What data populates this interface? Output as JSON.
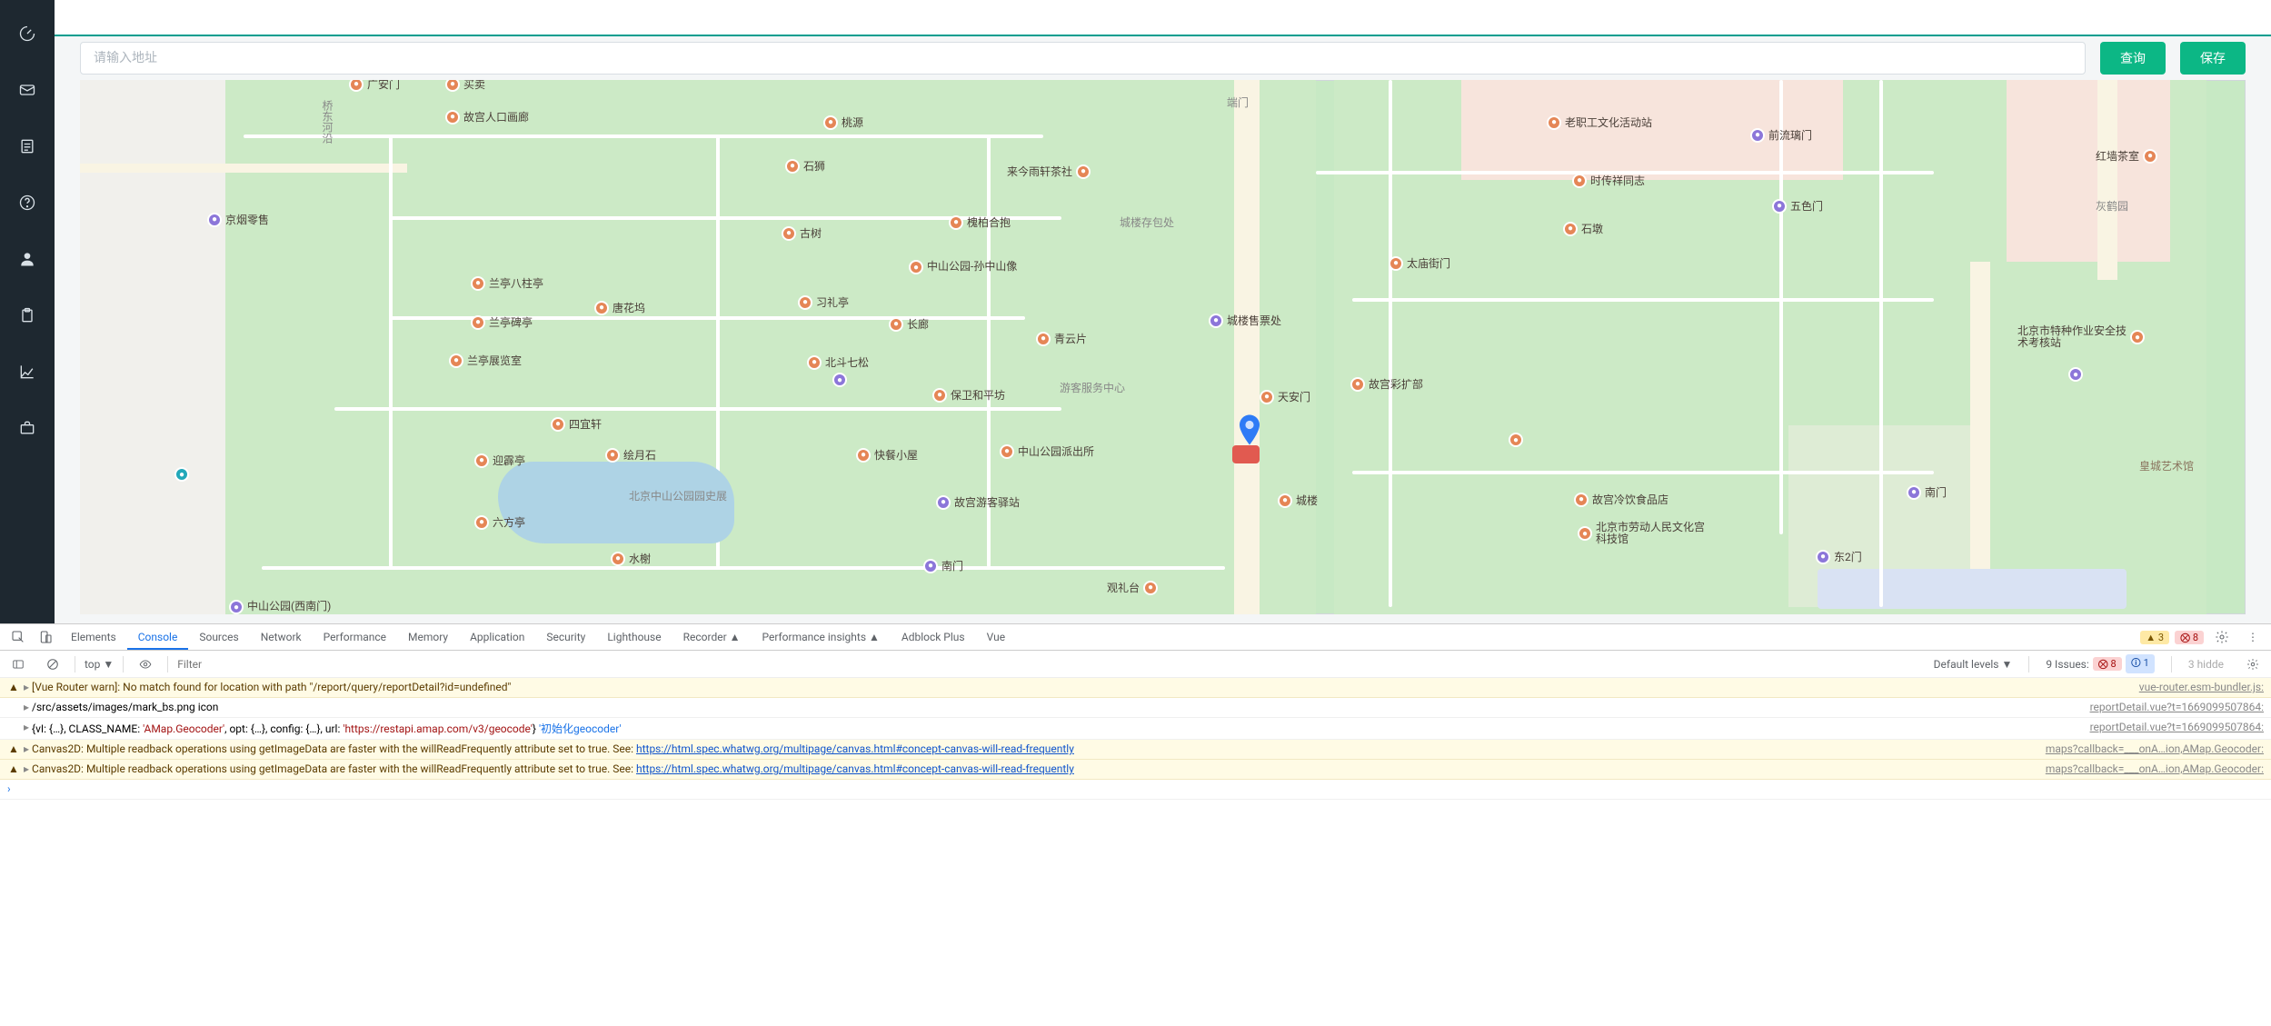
{
  "sidebar": {
    "items": [
      {
        "name": "sidebar-item-dashboard",
        "icon": "speedometer-icon"
      },
      {
        "name": "sidebar-item-inbox",
        "icon": "mail-icon"
      },
      {
        "name": "sidebar-item-docs",
        "icon": "document-icon"
      },
      {
        "name": "sidebar-item-help",
        "icon": "help-circle-icon"
      },
      {
        "name": "sidebar-item-user",
        "icon": "user-icon"
      },
      {
        "name": "sidebar-item-clipboard",
        "icon": "clipboard-icon"
      },
      {
        "name": "sidebar-item-chart",
        "icon": "chart-icon"
      },
      {
        "name": "sidebar-item-briefcase",
        "icon": "briefcase-icon"
      }
    ]
  },
  "search": {
    "placeholder": "请输入地址",
    "value": "",
    "query_label": "查询",
    "save_label": "保存"
  },
  "map": {
    "pois": [
      {
        "l": 296,
        "t": -4,
        "label": "广安门",
        "dot": "o"
      },
      {
        "l": 402,
        "t": -4,
        "label": "买卖",
        "dot": "o"
      },
      {
        "l": 1262,
        "t": 16,
        "label": "端门",
        "dot": "",
        "plain": true,
        "color": "#888"
      },
      {
        "l": 402,
        "t": 32,
        "label": "故宫人口画廊",
        "dot": "o"
      },
      {
        "l": 818,
        "t": 38,
        "label": "桃源",
        "dot": "o"
      },
      {
        "l": 264,
        "t": 22,
        "label": "桥东河沿",
        "dot": "",
        "plain": true,
        "vertical": true,
        "color": "#888"
      },
      {
        "l": 1614,
        "t": 38,
        "label": "老职工文化活动站",
        "dot": "o"
      },
      {
        "l": 1838,
        "t": 52,
        "label": "前流璃门",
        "dot": "p"
      },
      {
        "l": 776,
        "t": 86,
        "label": "石狮",
        "dot": "o"
      },
      {
        "l": 1020,
        "t": 92,
        "label": "来今雨轩茶社",
        "dot": "o",
        "flip": true
      },
      {
        "l": 1642,
        "t": 102,
        "label": "时传祥同志",
        "dot": "o"
      },
      {
        "l": 2218,
        "t": 75,
        "label": "红墙茶室",
        "dot": "o",
        "flip": true
      },
      {
        "l": 2218,
        "t": 130,
        "label": "灰鹤园",
        "dot": "",
        "plain": true,
        "color": "#888"
      },
      {
        "l": 140,
        "t": 145,
        "label": "京烟零售",
        "dot": "p"
      },
      {
        "l": 956,
        "t": 148,
        "label": "槐柏合抱",
        "dot": "o"
      },
      {
        "l": 1144,
        "t": 148,
        "label": "城楼存包处",
        "dot": "",
        "plain": true,
        "color": "#888"
      },
      {
        "l": 1862,
        "t": 130,
        "label": "五色门",
        "dot": "p"
      },
      {
        "l": 772,
        "t": 160,
        "label": "古树",
        "dot": "o"
      },
      {
        "l": 1632,
        "t": 155,
        "label": "石墩",
        "dot": "o"
      },
      {
        "l": 912,
        "t": 198,
        "label": "中山公园-孙中山像",
        "dot": "o",
        "two": true
      },
      {
        "l": 430,
        "t": 215,
        "label": "兰亭八柱亭",
        "dot": "o"
      },
      {
        "l": 1440,
        "t": 193,
        "label": "太庙街门",
        "dot": "o"
      },
      {
        "l": 566,
        "t": 242,
        "label": "唐花坞",
        "dot": "o"
      },
      {
        "l": 790,
        "t": 236,
        "label": "习礼亭",
        "dot": "o"
      },
      {
        "l": 430,
        "t": 258,
        "label": "兰亭碑亭",
        "dot": "o"
      },
      {
        "l": 890,
        "t": 260,
        "label": "长廊",
        "dot": "o"
      },
      {
        "l": 1242,
        "t": 256,
        "label": "城楼售票处",
        "dot": "p"
      },
      {
        "l": 2132,
        "t": 270,
        "label": "北京市特种作业安全技术考核站",
        "dot": "o",
        "two": true,
        "flip": true
      },
      {
        "l": 406,
        "t": 300,
        "label": "兰亭展览室",
        "dot": "o"
      },
      {
        "l": 1052,
        "t": 276,
        "label": "青云片",
        "dot": "o"
      },
      {
        "l": 800,
        "t": 302,
        "label": "北斗七松",
        "dot": "o"
      },
      {
        "l": 828,
        "t": 322,
        "label": "",
        "dot": "p",
        "purple_only": true
      },
      {
        "l": 1078,
        "t": 330,
        "label": "游客服务中心",
        "dot": "",
        "plain": true,
        "color": "#888"
      },
      {
        "l": 1298,
        "t": 340,
        "label": "天安门",
        "dot": "o"
      },
      {
        "l": 1398,
        "t": 326,
        "label": "故宫彩扩部",
        "dot": "o"
      },
      {
        "l": 2188,
        "t": 316,
        "label": "",
        "dot": "p",
        "purple_only": true
      },
      {
        "l": 938,
        "t": 338,
        "label": "保卫和平坊",
        "dot": "o"
      },
      {
        "l": 518,
        "t": 370,
        "label": "四宜轩",
        "dot": "o"
      },
      {
        "l": 578,
        "t": 404,
        "label": "绘月石",
        "dot": "o"
      },
      {
        "l": 434,
        "t": 410,
        "label": "迎霹亭",
        "dot": "o"
      },
      {
        "l": 854,
        "t": 404,
        "label": "快餐小屋",
        "dot": "o"
      },
      {
        "l": 1012,
        "t": 400,
        "label": "中山公园派出所",
        "dot": "o"
      },
      {
        "l": 1572,
        "t": 388,
        "label": "",
        "dot": "o",
        "orange_only": true
      },
      {
        "l": 2266,
        "t": 416,
        "label": "皇城艺术馆",
        "dot": "",
        "plain": true,
        "color": "#8a745e"
      },
      {
        "l": 942,
        "t": 456,
        "label": "故宫游客驿站",
        "dot": "p"
      },
      {
        "l": 604,
        "t": 452,
        "label": "北京中山公园园史展",
        "dot": "",
        "plain": true,
        "two": true,
        "color": "#888"
      },
      {
        "l": 1318,
        "t": 454,
        "label": "城楼",
        "dot": "o"
      },
      {
        "l": 1644,
        "t": 453,
        "label": "故宫冷饮食品店",
        "dot": "o"
      },
      {
        "l": 434,
        "t": 478,
        "label": "六方亭",
        "dot": "o"
      },
      {
        "l": 1648,
        "t": 486,
        "label": "北京市劳动人民文化宫科技馆",
        "dot": "o",
        "two": true
      },
      {
        "l": 1910,
        "t": 516,
        "label": "东2门",
        "dot": "p"
      },
      {
        "l": 584,
        "t": 518,
        "label": "水榭",
        "dot": "o"
      },
      {
        "l": 928,
        "t": 526,
        "label": "南门",
        "dot": "p"
      },
      {
        "l": 2010,
        "t": 445,
        "label": "南门",
        "dot": "p"
      },
      {
        "l": 104,
        "t": 426,
        "label": "",
        "dot": "t",
        "teal_only": true
      },
      {
        "l": 1130,
        "t": 550,
        "label": "观礼台",
        "dot": "o",
        "flip": true
      },
      {
        "l": 164,
        "t": 572,
        "label": "中山公园(西南门)",
        "dot": "p",
        "two": true
      }
    ]
  },
  "devtools": {
    "tabs": [
      "Elements",
      "Console",
      "Sources",
      "Network",
      "Performance",
      "Memory",
      "Application",
      "Security",
      "Lighthouse",
      "Recorder ▲",
      "Performance insights ▲",
      "Adblock Plus",
      "Vue"
    ],
    "active_tab": 1,
    "warn_count": "3",
    "err_count": "8",
    "scope": "top ▼",
    "filter_placeholder": "Filter",
    "levels": "Default levels ▼",
    "issues_label": "9 Issues:",
    "issues_err": "8",
    "issues_info": "1",
    "hidden": "3 hidde",
    "rows": [
      {
        "type": "warn",
        "msg_pre": "[Vue Router warn]: No match found for location with path \"/report/query/reportDetail?id=undefined\"",
        "src": "vue-router.esm-bundler.js:"
      },
      {
        "type": "log",
        "msg_pre": "/src/assets/images/mark_bs.png icon",
        "src": "reportDetail.vue?t=1669099507864:"
      },
      {
        "type": "log",
        "msg_obj": true,
        "obj_prefix": "{vI: {…}, CLASS_NAME: ",
        "obj_class": "'AMap.Geocoder'",
        "obj_mid": ", opt: {…}, config: {…}, url: ",
        "obj_url": "'https://restapi.amap.com/v3/geocode'",
        "obj_suffix": "}",
        "obj_tail": " '初始化geocoder'",
        "src": "reportDetail.vue?t=1669099507864:"
      },
      {
        "type": "warn",
        "msg_pre": "Canvas2D: Multiple readback operations using getImageData are faster with the willReadFrequently attribute set to true. See: ",
        "link": "https://html.spec.whatwg.org/multipage/canvas.html#concept-canvas-will-read-frequently",
        "src": "maps?callback=___onA…ion,AMap.Geocoder:"
      },
      {
        "type": "warn",
        "msg_pre": "Canvas2D: Multiple readback operations using getImageData are faster with the willReadFrequently attribute set to true. See: ",
        "link": "https://html.spec.whatwg.org/multipage/canvas.html#concept-canvas-will-read-frequently",
        "src": "maps?callback=___onA…ion,AMap.Geocoder:"
      }
    ],
    "prompt": "›"
  }
}
